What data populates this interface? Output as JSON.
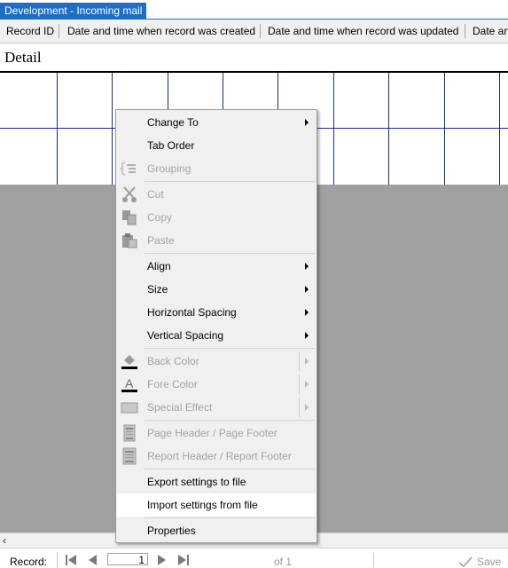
{
  "window": {
    "title": "Development - Incoming mail"
  },
  "header": {
    "columns": [
      "Record ID",
      "Date and time when record was created",
      "Date and time when record was updated",
      "Date an"
    ]
  },
  "section": {
    "title": "Detail"
  },
  "context_menu": {
    "items": {
      "change_to": "Change To",
      "tab_order": "Tab Order",
      "grouping": "Grouping",
      "cut": "Cut",
      "copy": "Copy",
      "paste": "Paste",
      "align": "Align",
      "size": "Size",
      "horizontal_spacing": "Horizontal Spacing",
      "vertical_spacing": "Vertical Spacing",
      "back_color": "Back Color",
      "fore_color": "Fore Color",
      "special_effect": "Special Effect",
      "page_header_footer": "Page Header / Page Footer",
      "report_header_footer": "Report Header / Report Footer",
      "export_settings": "Export settings to file",
      "import_settings": "Import settings from file",
      "properties": "Properties"
    },
    "highlighted": "Import settings from file"
  },
  "navigation": {
    "record_label": "Record:",
    "current": "1",
    "of_label": "of",
    "total": "1",
    "save_label": "Save"
  },
  "colors": {
    "title_bar": "#1e6fc4",
    "grid_lines": "#1c2a8c",
    "canvas_gray": "#a0a0a0"
  }
}
